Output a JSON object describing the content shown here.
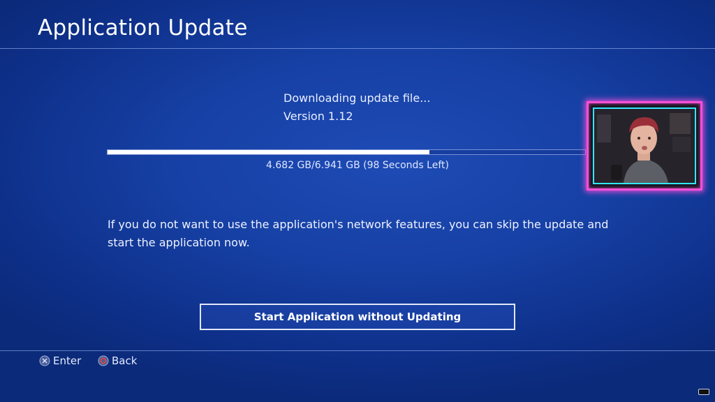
{
  "header": {
    "title": "Application Update"
  },
  "status": {
    "message": "Downloading update file...",
    "version": "Version 1.12"
  },
  "progress": {
    "fraction": 0.6745,
    "text": "4.682 GB/6.941 GB (98 Seconds Left)"
  },
  "info": {
    "text": "If you do not want to use the application's network features, you can skip the update and start the application now."
  },
  "actions": {
    "start_without_updating_label": "Start Application without Updating"
  },
  "footer": {
    "enter_label": "Enter",
    "back_label": "Back",
    "enter_icon": "cross-button-icon",
    "back_icon": "circle-button-icon"
  },
  "colors": {
    "background": "#1640a4",
    "progress_fill": "#ffffff",
    "webcam_border": "#ff4fd8",
    "webcam_inner_border": "#34e6ff",
    "circle_button": "#e0453f"
  }
}
